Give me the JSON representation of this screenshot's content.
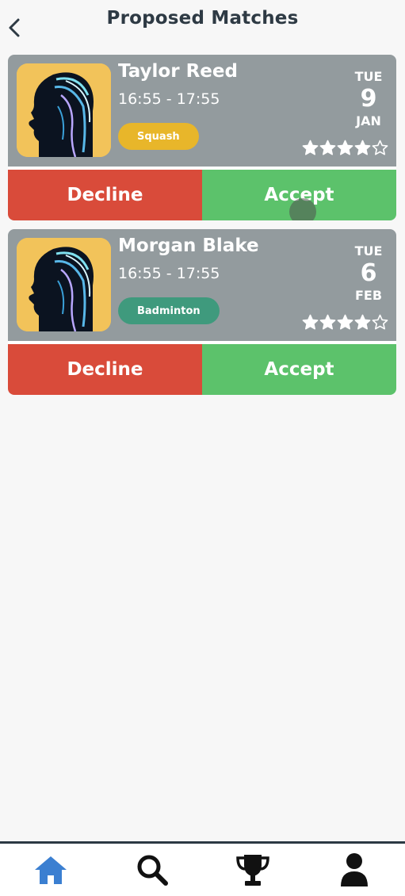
{
  "header": {
    "title": "Proposed Matches"
  },
  "matches": [
    {
      "name": "Taylor Reed",
      "time": "16:55 - 17:55",
      "sport": "Squash",
      "sport_color": "#e8b62a",
      "day_of_week": "TUE",
      "day": "9",
      "month": "JAN",
      "rating": 4,
      "decline_label": "Decline",
      "accept_label": "Accept"
    },
    {
      "name": "Morgan Blake",
      "time": "16:55 - 17:55",
      "sport": "Badminton",
      "sport_color": "#3f9a7d",
      "day_of_week": "TUE",
      "day": "6",
      "month": "FEB",
      "rating": 4,
      "decline_label": "Decline",
      "accept_label": "Accept"
    }
  ],
  "colors": {
    "card_background": "#939b9e",
    "decline": "#d94b3a",
    "accept": "#5cc26b",
    "avatar_background": "#f2c35a",
    "nav_active": "#3b7fd1",
    "nav_inactive": "#111111"
  },
  "nav": [
    {
      "icon": "home-icon",
      "active": true
    },
    {
      "icon": "search-icon",
      "active": false
    },
    {
      "icon": "trophy-icon",
      "active": false
    },
    {
      "icon": "profile-icon",
      "active": false
    }
  ]
}
